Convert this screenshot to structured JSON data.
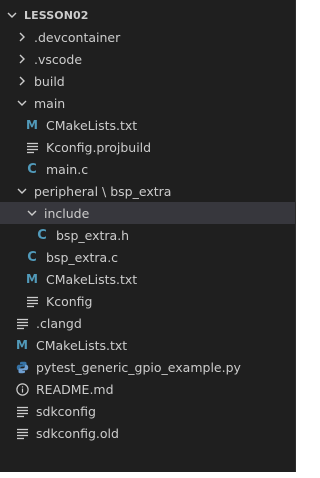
{
  "explorer": {
    "root_label": "LESSON02",
    "items": [
      {
        "label": ".devcontainer",
        "type": "folder",
        "expanded": false,
        "depth": 1,
        "icon": "chevron-right-icon"
      },
      {
        "label": ".vscode",
        "type": "folder",
        "expanded": false,
        "depth": 1,
        "icon": "chevron-right-icon"
      },
      {
        "label": "build",
        "type": "folder",
        "expanded": false,
        "depth": 1,
        "icon": "chevron-right-icon"
      },
      {
        "label": "main",
        "type": "folder",
        "expanded": true,
        "depth": 1,
        "icon": "chevron-down-icon"
      },
      {
        "label": "CMakeLists.txt",
        "type": "file",
        "depth": 2,
        "icon": "cmake-icon",
        "glyph": "M"
      },
      {
        "label": "Kconfig.projbuild",
        "type": "file",
        "depth": 2,
        "icon": "lines-icon"
      },
      {
        "label": "main.c",
        "type": "file",
        "depth": 2,
        "icon": "c-file-icon",
        "glyph": "C"
      },
      {
        "label": "peripheral \\ bsp_extra",
        "type": "folder",
        "expanded": true,
        "depth": 1,
        "icon": "chevron-down-icon"
      },
      {
        "label": "include",
        "type": "folder",
        "expanded": true,
        "depth": 2,
        "icon": "chevron-down-icon",
        "selected": true
      },
      {
        "label": "bsp_extra.h",
        "type": "file",
        "depth": 3,
        "icon": "c-file-icon",
        "glyph": "C"
      },
      {
        "label": "bsp_extra.c",
        "type": "file",
        "depth": 2,
        "icon": "c-file-icon",
        "glyph": "C"
      },
      {
        "label": "CMakeLists.txt",
        "type": "file",
        "depth": 2,
        "icon": "cmake-icon",
        "glyph": "M"
      },
      {
        "label": "Kconfig",
        "type": "file",
        "depth": 2,
        "icon": "lines-icon"
      },
      {
        "label": ".clangd",
        "type": "file",
        "depth": 1,
        "icon": "lines-icon"
      },
      {
        "label": "CMakeLists.txt",
        "type": "file",
        "depth": 1,
        "icon": "cmake-icon",
        "glyph": "M"
      },
      {
        "label": "pytest_generic_gpio_example.py",
        "type": "file",
        "depth": 1,
        "icon": "python-icon"
      },
      {
        "label": "README.md",
        "type": "file",
        "depth": 1,
        "icon": "info-icon"
      },
      {
        "label": "sdkconfig",
        "type": "file",
        "depth": 1,
        "icon": "lines-icon"
      },
      {
        "label": "sdkconfig.old",
        "type": "file",
        "depth": 1,
        "icon": "lines-icon"
      }
    ]
  },
  "colors": {
    "background": "#1f1f1f",
    "text": "#cccccc",
    "selected_row": "#37373d",
    "c_icon": "#519aba",
    "cmake_icon": "#519aba",
    "python_icon": "#3572A5"
  }
}
